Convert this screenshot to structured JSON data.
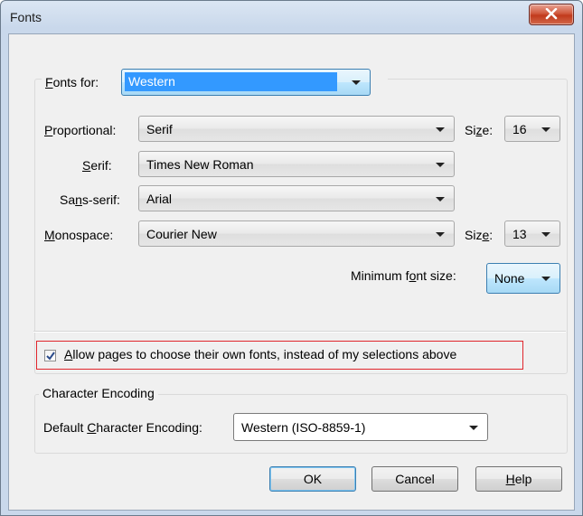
{
  "window": {
    "title": "Fonts"
  },
  "fonts_for": {
    "label_pre": "",
    "label_accel": "F",
    "label_post": "onts for:",
    "value": "Western"
  },
  "proportional": {
    "label_accel": "P",
    "label_post": "roportional:",
    "value": "Serif",
    "size_label_pre": "Si",
    "size_label_accel": "z",
    "size_label_post": "e:",
    "size_value": "16"
  },
  "serif": {
    "label_accel": "S",
    "label_post": "erif:",
    "value": "Times New Roman"
  },
  "sans_serif": {
    "label_pre": "Sa",
    "label_accel": "n",
    "label_post": "s-serif:",
    "value": "Arial"
  },
  "monospace": {
    "label_accel": "M",
    "label_post": "onospace:",
    "value": "Courier New",
    "size_label_pre": "Siz",
    "size_label_accel": "e",
    "size_label_post": ":",
    "size_value": "13"
  },
  "minimum_font_size": {
    "label_pre": "Minimum f",
    "label_accel": "o",
    "label_post": "nt size:",
    "value": "None"
  },
  "allow_pages": {
    "label_accel": "A",
    "label_post": "llow pages to choose their own fonts, instead of my selections above",
    "checked": true
  },
  "character_encoding": {
    "group_label": "Character Encoding",
    "label_pre": "Default ",
    "label_accel": "C",
    "label_post": "haracter Encoding:",
    "value": "Western (ISO-8859-1)"
  },
  "buttons": {
    "ok": "OK",
    "cancel": "Cancel",
    "help_accel": "H",
    "help_post": "elp"
  },
  "icons": {
    "close": "close-icon",
    "dropdown": "chevron-down-icon",
    "check": "checkmark-icon"
  },
  "colors": {
    "highlight": "#3399ff",
    "focus_border": "#3c7fb1",
    "annotation_box": "#e0252b",
    "close_button": "#c13a1c"
  }
}
